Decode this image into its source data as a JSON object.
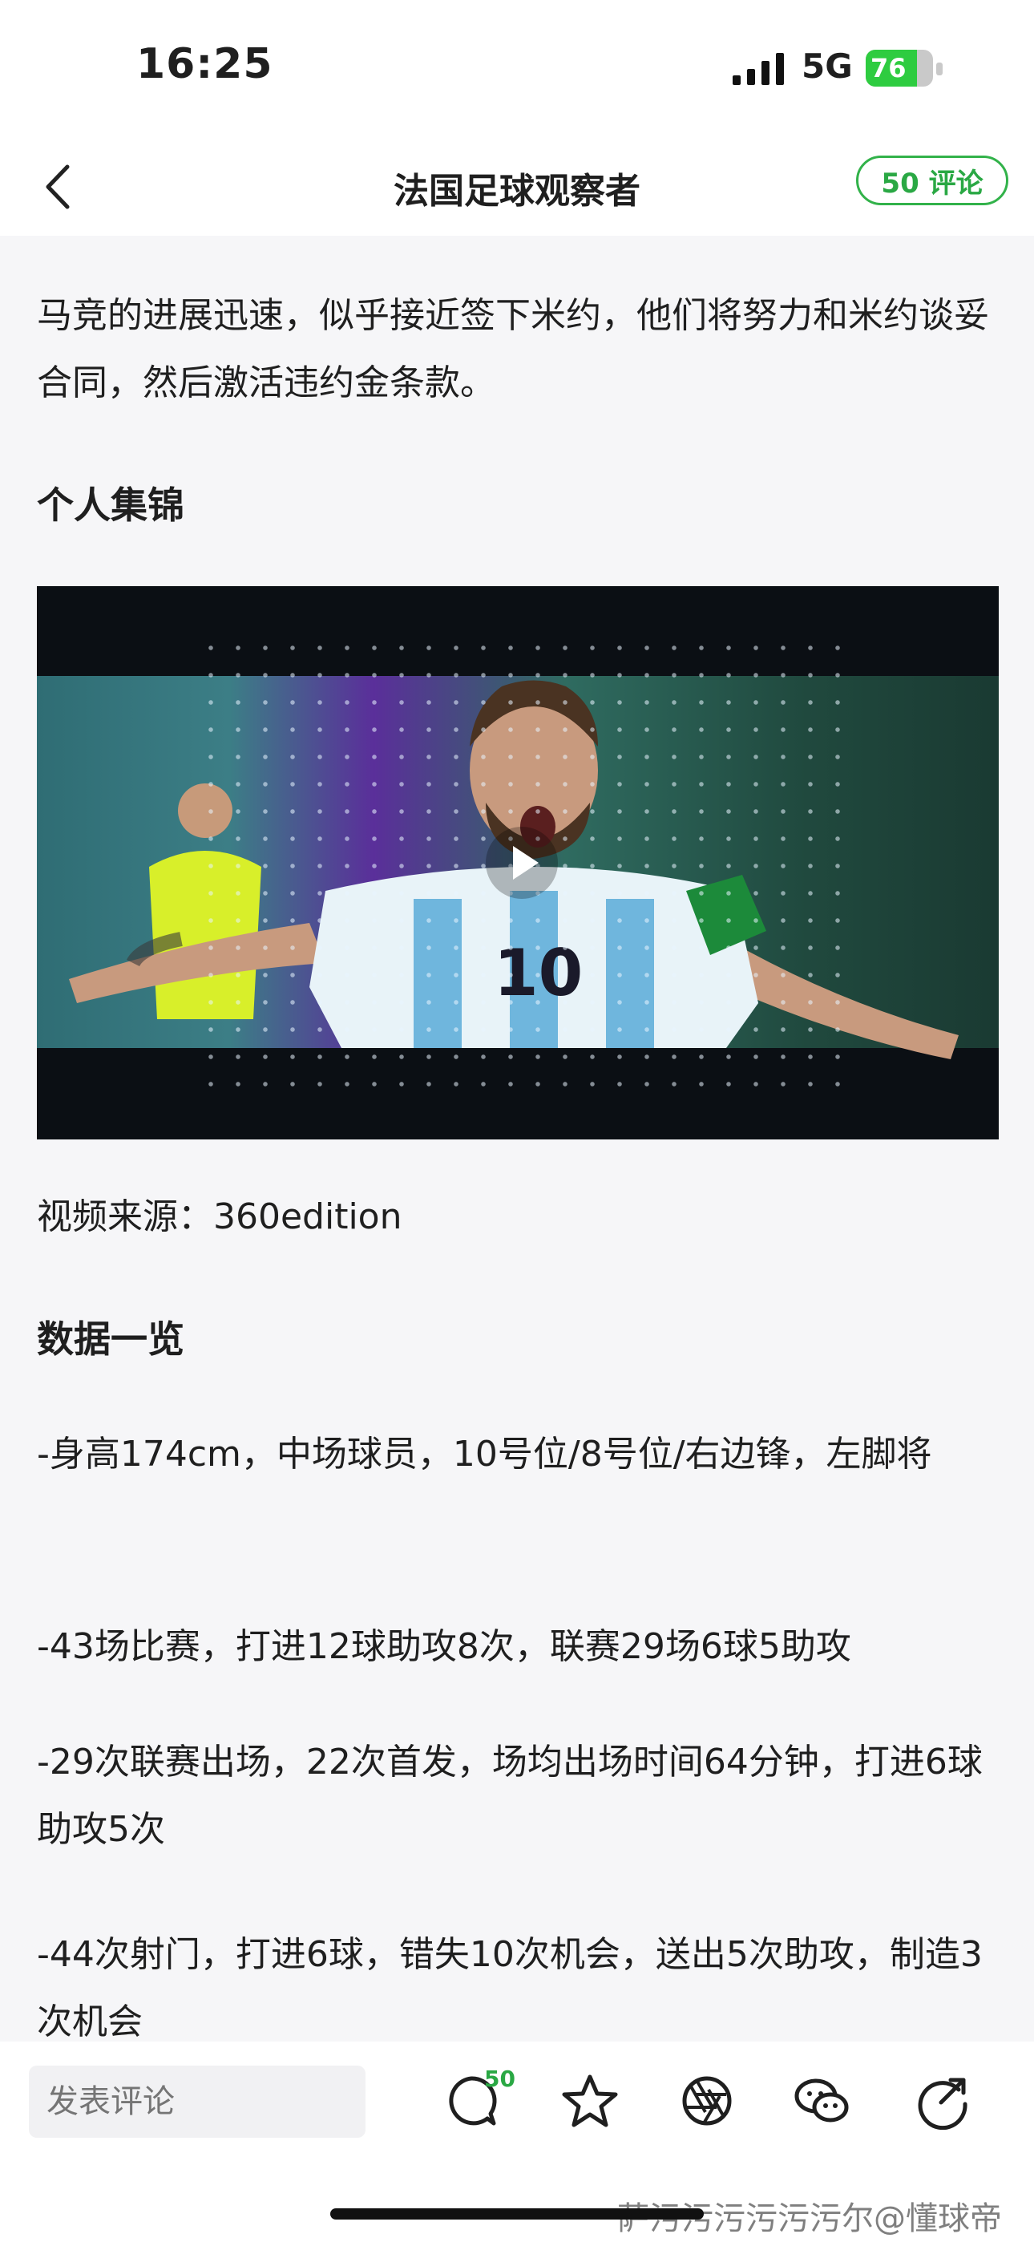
{
  "status_bar": {
    "time": "16:25",
    "network": "5G",
    "battery": "76",
    "battery_level": 0.76
  },
  "header": {
    "title": "法国足球观察者",
    "comments_label": "50 评论"
  },
  "article": {
    "intro": "马竞的进展迅速，似乎接近签下米约，他们将努力和米约谈妥合同，然后激活违约金条款。",
    "section_highlights": "个人集锦",
    "video_source": "视频来源：360edition",
    "section_stats": "数据一览",
    "stats": [
      "-身高174cm，中场球员，10号位/8号位/右边锋，左脚将",
      "-43场比赛，打进12球助攻8次，联赛29场6球5助攻",
      "-29次联赛出场，22次首发，场均出场时间64分钟，打进6球助攻5次",
      "-44次射门，打进6球，错失10次机会，送出5次助攻，制造3次机会"
    ],
    "jersey_number": "10"
  },
  "bottom_bar": {
    "comment_placeholder": "发表评论",
    "comment_count": "50",
    "icons": [
      "comment-icon",
      "star-icon",
      "share-aperture-icon",
      "wechat-icon",
      "forward-icon"
    ]
  },
  "watermark": "萨污污污污污污尔@懂球帝",
  "colors": {
    "accent": "#2aa844",
    "background": "#f6f6f8"
  }
}
